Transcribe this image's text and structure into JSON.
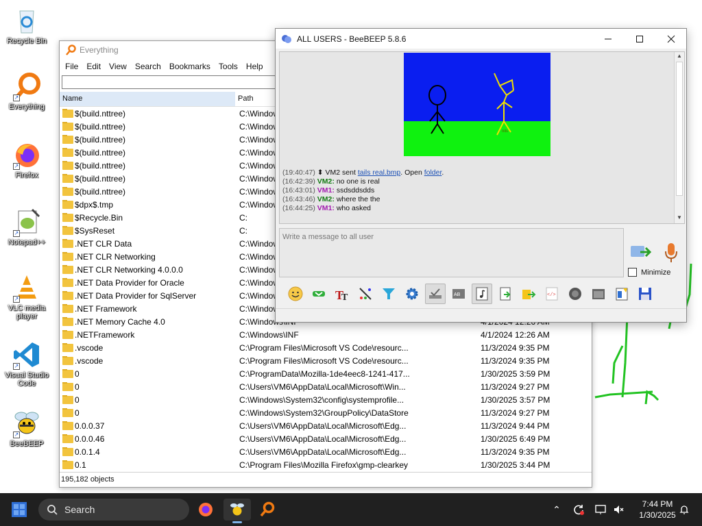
{
  "desktop": {
    "icons": [
      {
        "label": "Recycle Bin"
      },
      {
        "label": "Everything"
      },
      {
        "label": "Firefox"
      },
      {
        "label": "Notepad++"
      },
      {
        "label": "VLC media player"
      },
      {
        "label": "Visual Studio Code"
      },
      {
        "label": "BeeBEEP"
      }
    ]
  },
  "everything": {
    "title": "Everything",
    "menu": [
      "File",
      "Edit",
      "View",
      "Search",
      "Bookmarks",
      "Tools",
      "Help"
    ],
    "search_value": "",
    "columns": {
      "name": "Name",
      "path": "Path"
    },
    "rows": [
      {
        "name": "$(build.nttree)",
        "path": "C:\\Windows",
        "date": ""
      },
      {
        "name": "$(build.nttree)",
        "path": "C:\\Windows",
        "date": ""
      },
      {
        "name": "$(build.nttree)",
        "path": "C:\\Windows",
        "date": ""
      },
      {
        "name": "$(build.nttree)",
        "path": "C:\\Windows",
        "date": ""
      },
      {
        "name": "$(build.nttree)",
        "path": "C:\\Windows",
        "date": ""
      },
      {
        "name": "$(build.nttree)",
        "path": "C:\\Windows",
        "date": ""
      },
      {
        "name": "$(build.nttree)",
        "path": "C:\\Windows",
        "date": ""
      },
      {
        "name": "$dpx$.tmp",
        "path": "C:\\Windows",
        "date": ""
      },
      {
        "name": "$Recycle.Bin",
        "path": "C:",
        "date": ""
      },
      {
        "name": "$SysReset",
        "path": "C:",
        "date": ""
      },
      {
        "name": ".NET CLR Data",
        "path": "C:\\Windows",
        "date": ""
      },
      {
        "name": ".NET CLR Networking",
        "path": "C:\\Windows",
        "date": ""
      },
      {
        "name": ".NET CLR Networking 4.0.0.0",
        "path": "C:\\Windows",
        "date": ""
      },
      {
        "name": ".NET Data Provider for Oracle",
        "path": "C:\\Windows",
        "date": ""
      },
      {
        "name": ".NET Data Provider for SqlServer",
        "path": "C:\\Windows",
        "date": ""
      },
      {
        "name": ".NET Framework",
        "path": "C:\\Windows",
        "date": ""
      },
      {
        "name": ".NET Memory Cache 4.0",
        "path": "C:\\Windows\\INF",
        "date": "4/1/2024 12:26 AM"
      },
      {
        "name": ".NETFramework",
        "path": "C:\\Windows\\INF",
        "date": "4/1/2024 12:26 AM"
      },
      {
        "name": ".vscode",
        "path": "C:\\Program Files\\Microsoft VS Code\\resourc...",
        "date": "11/3/2024 9:35 PM"
      },
      {
        "name": ".vscode",
        "path": "C:\\Program Files\\Microsoft VS Code\\resourc...",
        "date": "11/3/2024 9:35 PM"
      },
      {
        "name": "0",
        "path": "C:\\ProgramData\\Mozilla-1de4eec8-1241-417...",
        "date": "1/30/2025 3:59 PM"
      },
      {
        "name": "0",
        "path": "C:\\Users\\VM6\\AppData\\Local\\Microsoft\\Win...",
        "date": "11/3/2024 9:27 PM"
      },
      {
        "name": "0",
        "path": "C:\\Windows\\System32\\config\\systemprofile...",
        "date": "1/30/2025 3:57 PM"
      },
      {
        "name": "0",
        "path": "C:\\Windows\\System32\\GroupPolicy\\DataStore",
        "date": "11/3/2024 9:27 PM"
      },
      {
        "name": "0.0.0.37",
        "path": "C:\\Users\\VM6\\AppData\\Local\\Microsoft\\Edg...",
        "date": "11/3/2024 9:44 PM"
      },
      {
        "name": "0.0.0.46",
        "path": "C:\\Users\\VM6\\AppData\\Local\\Microsoft\\Edg...",
        "date": "1/30/2025 6:49 PM"
      },
      {
        "name": "0.0.1.4",
        "path": "C:\\Users\\VM6\\AppData\\Local\\Microsoft\\Edg...",
        "date": "11/3/2024 9:35 PM"
      },
      {
        "name": "0.1",
        "path": "C:\\Program Files\\Mozilla Firefox\\gmp-clearkey",
        "date": "1/30/2025 3:44 PM"
      }
    ],
    "status": "195,182 objects"
  },
  "beebeep": {
    "title": "ALL USERS - BeeBEEP 5.8.6",
    "image_caption": "nils",
    "file_msg": {
      "time": "(19:40:47)",
      "pre": "VM2 sent",
      "file": "tails real.bmp",
      "mid": ". Open",
      "folder": "folder",
      "post": "."
    },
    "messages": [
      {
        "time": "(16:42:39)",
        "user": "VM2:",
        "text": "no one is real",
        "color": "vm2"
      },
      {
        "time": "(16:43:01)",
        "user": "VM1:",
        "text": "ssdsddsdds",
        "color": "vm1"
      },
      {
        "time": "(16:43:46)",
        "user": "VM2:",
        "text": "where the the",
        "color": "vm2"
      },
      {
        "time": "(16:44:25)",
        "user": "VM1:",
        "text": "who asked",
        "color": "vm1"
      }
    ],
    "input_placeholder": "Write a message to all user",
    "minimize_label": "Minimize",
    "toolbar_icons": [
      "emoticon-icon",
      "send-file-icon",
      "font-icon",
      "color-icon",
      "filter-icon",
      "settings-icon",
      "spellcheck-icon",
      "enter-send-icon",
      "beep-icon",
      "save-chat-icon",
      "share-icon",
      "html-icon",
      "record-icon",
      "screenshot-icon",
      "notes-icon",
      "save-icon"
    ]
  },
  "taskbar": {
    "search_label": "Search",
    "time": "7:44 PM",
    "date": "1/30/2025"
  }
}
